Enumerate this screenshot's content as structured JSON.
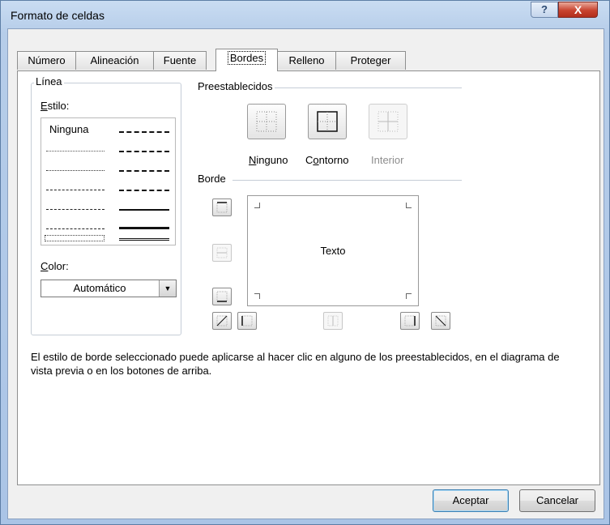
{
  "window": {
    "title": "Formato de celdas",
    "help_glyph": "?",
    "close_glyph": "X"
  },
  "tabs": [
    {
      "label": "Número"
    },
    {
      "label": "Alineación"
    },
    {
      "label": "Fuente"
    },
    {
      "label": "Bordes"
    },
    {
      "label": "Relleno"
    },
    {
      "label": "Proteger"
    }
  ],
  "active_tab": "Bordes",
  "linea": {
    "group_label": "Línea",
    "style_label": "Estilo:",
    "none_label": "Ninguna",
    "color_label": "Color:",
    "color_value": "Automático"
  },
  "presets": {
    "group_label": "Preestablecidos",
    "items": [
      {
        "label": "Ninguno"
      },
      {
        "label": "Contorno"
      },
      {
        "label": "Interior"
      }
    ]
  },
  "borde": {
    "group_label": "Borde",
    "preview_text": "Texto"
  },
  "description": "El estilo de borde seleccionado puede aplicarse al hacer clic en alguno de los preestablecidos, en el diagrama de vista previa o en los botones de arriba.",
  "buttons": {
    "accept": "Aceptar",
    "cancel": "Cancelar"
  },
  "colors": {
    "title_bar": "#b6cde9",
    "close_button": "#c8432f",
    "dialog_bg": "#f0f0f0",
    "default_button_border": "#3c7fb1"
  }
}
